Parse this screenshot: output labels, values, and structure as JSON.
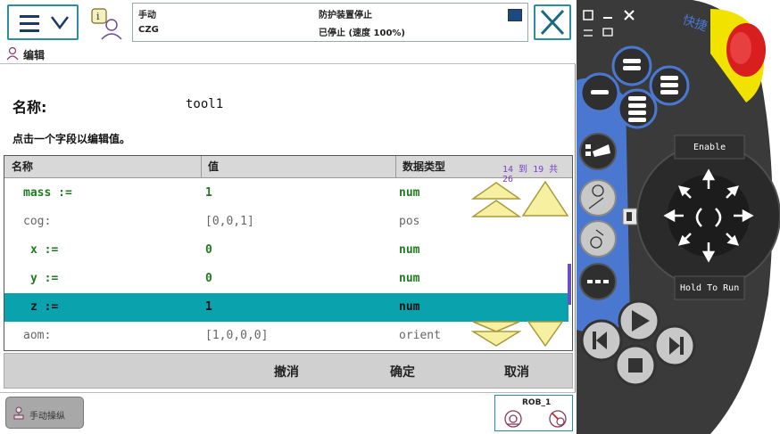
{
  "header": {
    "mode": "手动",
    "controller": "CZG",
    "state": "防护装置停止",
    "speed": "已停止 (速度 100%)"
  },
  "title": "编辑",
  "name_label": "名称:",
  "name_value": "tool1",
  "hint": "点击一个字段以编辑值。",
  "table": {
    "columns": [
      "名称",
      "值",
      "数据类型"
    ],
    "range": "14 到 19 共 26",
    "rows": [
      {
        "name": "mass :=",
        "value": "1",
        "type": "num",
        "editable": true,
        "selected": false
      },
      {
        "name": "cog:",
        "value": "[0,0,1]",
        "type": "pos",
        "editable": false,
        "selected": false
      },
      {
        "name": "x :=",
        "value": "0",
        "type": "num",
        "editable": true,
        "selected": false
      },
      {
        "name": "y :=",
        "value": "0",
        "type": "num",
        "editable": true,
        "selected": false
      },
      {
        "name": "z :=",
        "value": "1",
        "type": "num",
        "editable": true,
        "selected": true
      },
      {
        "name": "aom:",
        "value": "[1,0,0,0]",
        "type": "orient",
        "editable": false,
        "selected": false
      }
    ]
  },
  "actions": {
    "undo": "撤消",
    "ok": "确定",
    "cancel": "取消"
  },
  "taskbar": {
    "jog": "手动操纵",
    "robot": "ROB_1"
  },
  "pendant": {
    "enable": "Enable",
    "hold_to_run": "Hold To Run",
    "logo": "快捷"
  },
  "colors": {
    "accent": "#2a8da0",
    "selected_row": "#0aa3ad",
    "editable_text": "#1f7a1f",
    "pendant_body": "#3a3a3a",
    "pendant_blue": "#4a78d0",
    "estop": "#d81e1e"
  }
}
